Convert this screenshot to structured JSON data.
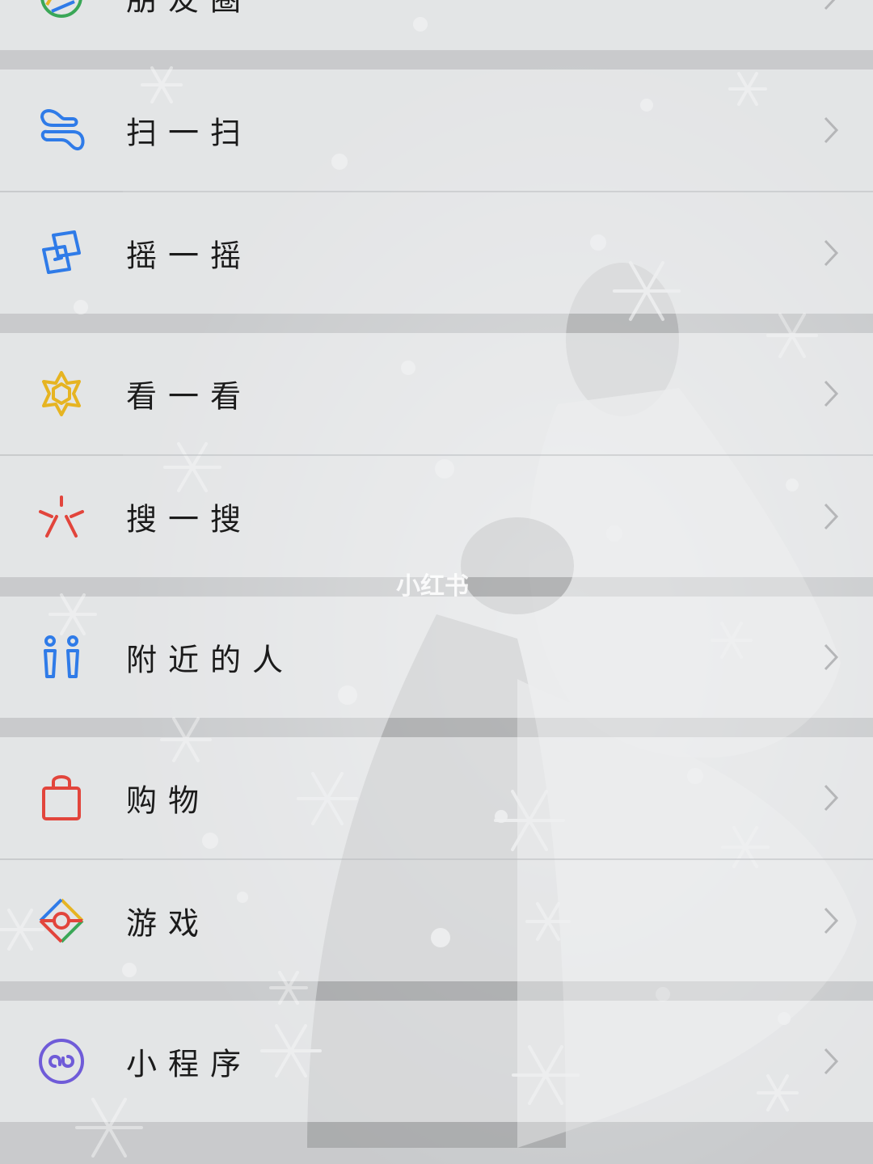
{
  "menu": {
    "top_partial_label": "朋友圈",
    "items": [
      {
        "label": "扫一扫",
        "icon": "scan-icon"
      },
      {
        "label": "摇一摇",
        "icon": "shake-icon"
      },
      {
        "label": "看一看",
        "icon": "look-icon"
      },
      {
        "label": "搜一搜",
        "icon": "search-icon"
      },
      {
        "label": "附近的人",
        "icon": "nearby-people-icon"
      },
      {
        "label": "购物",
        "icon": "shopping-bag-icon"
      },
      {
        "label": "游戏",
        "icon": "game-icon"
      },
      {
        "label": "小程序",
        "icon": "mini-program-icon"
      }
    ]
  },
  "watermark": "小红书",
  "colors": {
    "scan": "#2f7be8",
    "shake": "#2f7be8",
    "look": "#e6b422",
    "search": "#e2453c",
    "nearby": "#2f7be8",
    "shopping": "#e2453c",
    "mini_program": "#6f5bd8"
  }
}
